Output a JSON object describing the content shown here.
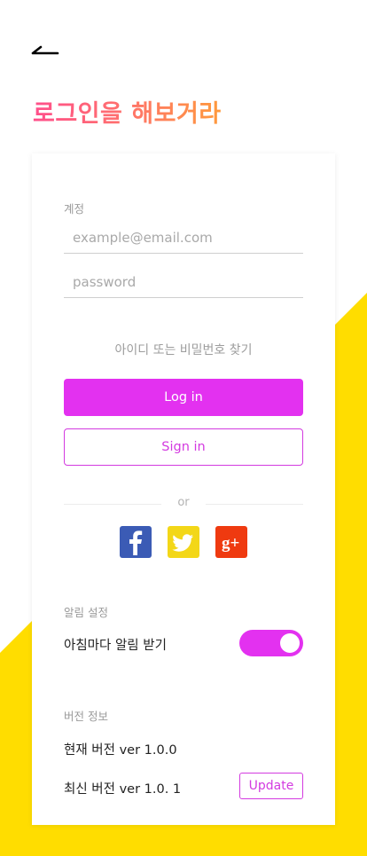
{
  "header": {
    "back_icon": "back-arrow-icon",
    "title_part1": "로그인을",
    "title_part2": "해보거라"
  },
  "login": {
    "account_label": "계정",
    "email_placeholder": "example@email.com",
    "password_placeholder": "password",
    "find_link": "아이디 또는 비밀번호 찾기",
    "login_button": "Log in",
    "signin_button": "Sign in",
    "or_text": "or"
  },
  "social": {
    "facebook_icon": "facebook-icon",
    "twitter_icon": "twitter-icon",
    "google_plus_icon": "google-plus-icon",
    "google_plus_glyph": "g+"
  },
  "notifications": {
    "section_label": "알림 설정",
    "morning_alert_label": "아침마다 알림 받기",
    "morning_alert_on": true
  },
  "version": {
    "section_label": "버전 정보",
    "current_version": "현재 버전 ver 1.0.0",
    "latest_version": "최신 버전 ver 1.0. 1",
    "update_button": "Update"
  },
  "colors": {
    "accent": "#e331f0",
    "background_shape": "#ffdd00",
    "title_gradient_start": "#ff4f8b",
    "title_gradient_end": "#ff9a3c",
    "facebook": "#3b5bb5",
    "twitter": "#f3d718",
    "google_plus": "#ef3a10"
  }
}
